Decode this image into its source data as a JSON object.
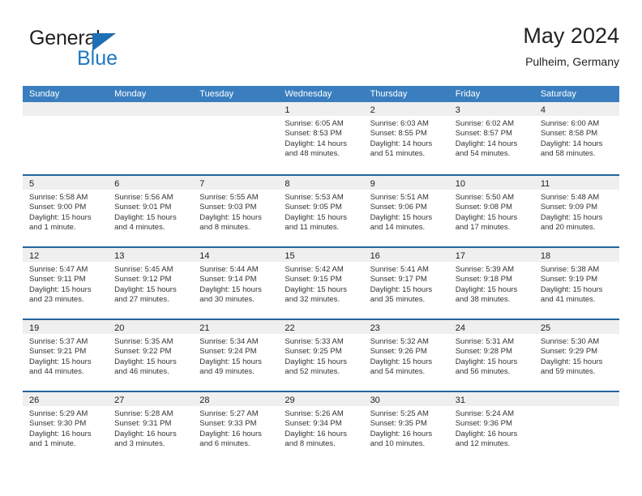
{
  "brand": {
    "name_top": "General",
    "name_bottom": "Blue",
    "triangle_color": "#1f6fb5",
    "text_color_top": "#231f20",
    "text_color_bottom": "#1f78c1"
  },
  "header": {
    "title": "May 2024",
    "subtitle": "Pulheim, Germany"
  },
  "colors": {
    "header_band": "#3a7ebf",
    "row_divider": "#23649e",
    "day_strip": "#efefef",
    "text": "#333333"
  },
  "weekdays": [
    "Sunday",
    "Monday",
    "Tuesday",
    "Wednesday",
    "Thursday",
    "Friday",
    "Saturday"
  ],
  "weeks": [
    [
      {
        "day": "",
        "empty": true,
        "lines": []
      },
      {
        "day": "",
        "empty": true,
        "lines": []
      },
      {
        "day": "",
        "empty": true,
        "lines": []
      },
      {
        "day": "1",
        "empty": false,
        "lines": [
          "Sunrise: 6:05 AM",
          "Sunset: 8:53 PM",
          "Daylight: 14 hours",
          "and 48 minutes."
        ]
      },
      {
        "day": "2",
        "empty": false,
        "lines": [
          "Sunrise: 6:03 AM",
          "Sunset: 8:55 PM",
          "Daylight: 14 hours",
          "and 51 minutes."
        ]
      },
      {
        "day": "3",
        "empty": false,
        "lines": [
          "Sunrise: 6:02 AM",
          "Sunset: 8:57 PM",
          "Daylight: 14 hours",
          "and 54 minutes."
        ]
      },
      {
        "day": "4",
        "empty": false,
        "lines": [
          "Sunrise: 6:00 AM",
          "Sunset: 8:58 PM",
          "Daylight: 14 hours",
          "and 58 minutes."
        ]
      }
    ],
    [
      {
        "day": "5",
        "empty": false,
        "lines": [
          "Sunrise: 5:58 AM",
          "Sunset: 9:00 PM",
          "Daylight: 15 hours",
          "and 1 minute."
        ]
      },
      {
        "day": "6",
        "empty": false,
        "lines": [
          "Sunrise: 5:56 AM",
          "Sunset: 9:01 PM",
          "Daylight: 15 hours",
          "and 4 minutes."
        ]
      },
      {
        "day": "7",
        "empty": false,
        "lines": [
          "Sunrise: 5:55 AM",
          "Sunset: 9:03 PM",
          "Daylight: 15 hours",
          "and 8 minutes."
        ]
      },
      {
        "day": "8",
        "empty": false,
        "lines": [
          "Sunrise: 5:53 AM",
          "Sunset: 9:05 PM",
          "Daylight: 15 hours",
          "and 11 minutes."
        ]
      },
      {
        "day": "9",
        "empty": false,
        "lines": [
          "Sunrise: 5:51 AM",
          "Sunset: 9:06 PM",
          "Daylight: 15 hours",
          "and 14 minutes."
        ]
      },
      {
        "day": "10",
        "empty": false,
        "lines": [
          "Sunrise: 5:50 AM",
          "Sunset: 9:08 PM",
          "Daylight: 15 hours",
          "and 17 minutes."
        ]
      },
      {
        "day": "11",
        "empty": false,
        "lines": [
          "Sunrise: 5:48 AM",
          "Sunset: 9:09 PM",
          "Daylight: 15 hours",
          "and 20 minutes."
        ]
      }
    ],
    [
      {
        "day": "12",
        "empty": false,
        "lines": [
          "Sunrise: 5:47 AM",
          "Sunset: 9:11 PM",
          "Daylight: 15 hours",
          "and 23 minutes."
        ]
      },
      {
        "day": "13",
        "empty": false,
        "lines": [
          "Sunrise: 5:45 AM",
          "Sunset: 9:12 PM",
          "Daylight: 15 hours",
          "and 27 minutes."
        ]
      },
      {
        "day": "14",
        "empty": false,
        "lines": [
          "Sunrise: 5:44 AM",
          "Sunset: 9:14 PM",
          "Daylight: 15 hours",
          "and 30 minutes."
        ]
      },
      {
        "day": "15",
        "empty": false,
        "lines": [
          "Sunrise: 5:42 AM",
          "Sunset: 9:15 PM",
          "Daylight: 15 hours",
          "and 32 minutes."
        ]
      },
      {
        "day": "16",
        "empty": false,
        "lines": [
          "Sunrise: 5:41 AM",
          "Sunset: 9:17 PM",
          "Daylight: 15 hours",
          "and 35 minutes."
        ]
      },
      {
        "day": "17",
        "empty": false,
        "lines": [
          "Sunrise: 5:39 AM",
          "Sunset: 9:18 PM",
          "Daylight: 15 hours",
          "and 38 minutes."
        ]
      },
      {
        "day": "18",
        "empty": false,
        "lines": [
          "Sunrise: 5:38 AM",
          "Sunset: 9:19 PM",
          "Daylight: 15 hours",
          "and 41 minutes."
        ]
      }
    ],
    [
      {
        "day": "19",
        "empty": false,
        "lines": [
          "Sunrise: 5:37 AM",
          "Sunset: 9:21 PM",
          "Daylight: 15 hours",
          "and 44 minutes."
        ]
      },
      {
        "day": "20",
        "empty": false,
        "lines": [
          "Sunrise: 5:35 AM",
          "Sunset: 9:22 PM",
          "Daylight: 15 hours",
          "and 46 minutes."
        ]
      },
      {
        "day": "21",
        "empty": false,
        "lines": [
          "Sunrise: 5:34 AM",
          "Sunset: 9:24 PM",
          "Daylight: 15 hours",
          "and 49 minutes."
        ]
      },
      {
        "day": "22",
        "empty": false,
        "lines": [
          "Sunrise: 5:33 AM",
          "Sunset: 9:25 PM",
          "Daylight: 15 hours",
          "and 52 minutes."
        ]
      },
      {
        "day": "23",
        "empty": false,
        "lines": [
          "Sunrise: 5:32 AM",
          "Sunset: 9:26 PM",
          "Daylight: 15 hours",
          "and 54 minutes."
        ]
      },
      {
        "day": "24",
        "empty": false,
        "lines": [
          "Sunrise: 5:31 AM",
          "Sunset: 9:28 PM",
          "Daylight: 15 hours",
          "and 56 minutes."
        ]
      },
      {
        "day": "25",
        "empty": false,
        "lines": [
          "Sunrise: 5:30 AM",
          "Sunset: 9:29 PM",
          "Daylight: 15 hours",
          "and 59 minutes."
        ]
      }
    ],
    [
      {
        "day": "26",
        "empty": false,
        "lines": [
          "Sunrise: 5:29 AM",
          "Sunset: 9:30 PM",
          "Daylight: 16 hours",
          "and 1 minute."
        ]
      },
      {
        "day": "27",
        "empty": false,
        "lines": [
          "Sunrise: 5:28 AM",
          "Sunset: 9:31 PM",
          "Daylight: 16 hours",
          "and 3 minutes."
        ]
      },
      {
        "day": "28",
        "empty": false,
        "lines": [
          "Sunrise: 5:27 AM",
          "Sunset: 9:33 PM",
          "Daylight: 16 hours",
          "and 6 minutes."
        ]
      },
      {
        "day": "29",
        "empty": false,
        "lines": [
          "Sunrise: 5:26 AM",
          "Sunset: 9:34 PM",
          "Daylight: 16 hours",
          "and 8 minutes."
        ]
      },
      {
        "day": "30",
        "empty": false,
        "lines": [
          "Sunrise: 5:25 AM",
          "Sunset: 9:35 PM",
          "Daylight: 16 hours",
          "and 10 minutes."
        ]
      },
      {
        "day": "31",
        "empty": false,
        "lines": [
          "Sunrise: 5:24 AM",
          "Sunset: 9:36 PM",
          "Daylight: 16 hours",
          "and 12 minutes."
        ]
      },
      {
        "day": "",
        "empty": true,
        "lines": []
      }
    ]
  ]
}
